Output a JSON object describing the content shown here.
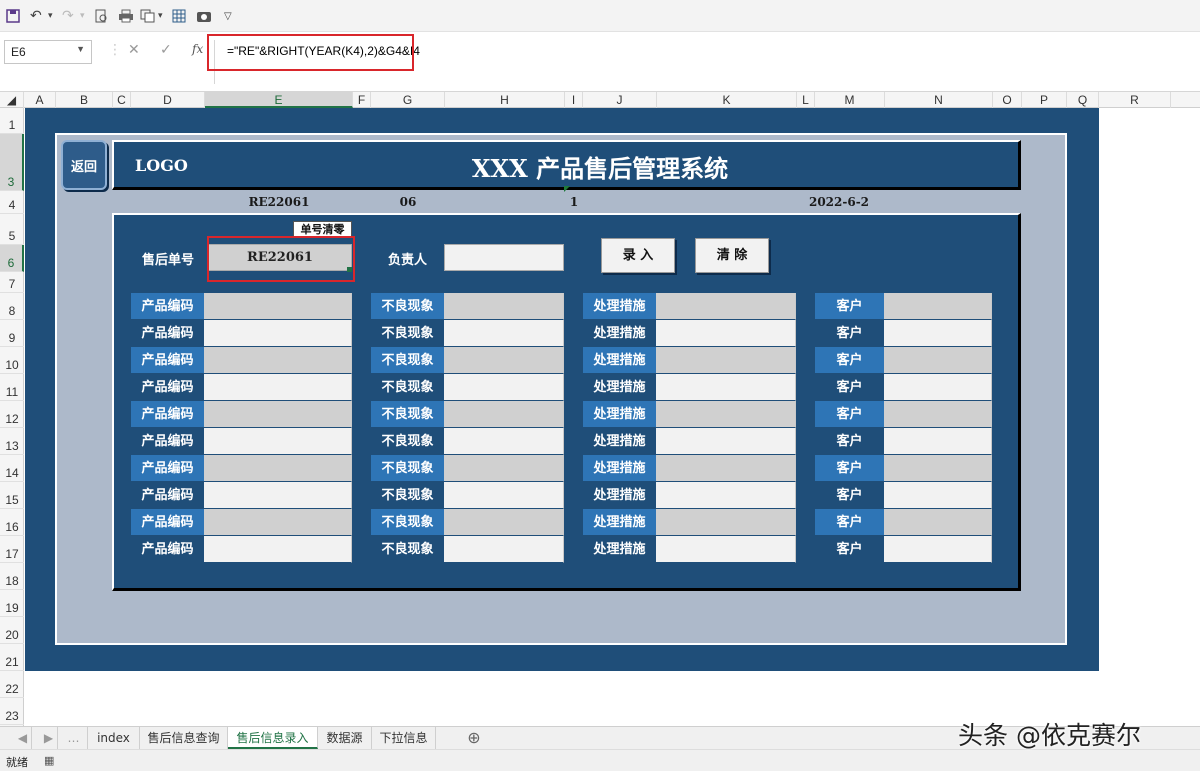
{
  "formula_bar": {
    "cell_ref": "E6",
    "formula": "=\"RE\"&RIGHT(YEAR(K4),2)&G4&I4",
    "fx_label": "fx"
  },
  "columns": [
    "A",
    "B",
    "C",
    "D",
    "E",
    "F",
    "G",
    "H",
    "I",
    "J",
    "K",
    "L",
    "M",
    "N",
    "O",
    "P",
    "Q",
    "R"
  ],
  "rows": [
    "1",
    "3",
    "4",
    "5",
    "6",
    "7",
    "8",
    "9",
    "10",
    "11",
    "12",
    "13",
    "14",
    "15",
    "16",
    "17",
    "18",
    "19",
    "20",
    "21",
    "22",
    "23"
  ],
  "header": {
    "back_label": "返回",
    "logo": "LOGO",
    "title": "XXX 产品售后管理系统"
  },
  "row4": {
    "order_no": "RE22061",
    "month": "06",
    "seq": "1",
    "date": "2022-6-2"
  },
  "form": {
    "clear_no_label": "单号清零",
    "order_label": "售后单号",
    "order_value": "RE22061",
    "owner_label": "负责人",
    "owner_value": "",
    "entry_label": "录 入",
    "clear_label": "清 除"
  },
  "table": {
    "col_labels": [
      "产品编码",
      "不良现象",
      "处理措施",
      "客户"
    ],
    "row_count": 10
  },
  "sheet_tabs": [
    "index",
    "售后信息查询",
    "售后信息录入",
    "数据源",
    "下拉信息"
  ],
  "active_tab": "售后信息录入",
  "status": "就绪",
  "watermark": "头条 @依克赛尔",
  "colors": {
    "dark_blue": "#1f4e79",
    "mid_blue": "#2e75b6",
    "gray_bg": "#adb9ca",
    "highlight_red": "#d9262b"
  }
}
